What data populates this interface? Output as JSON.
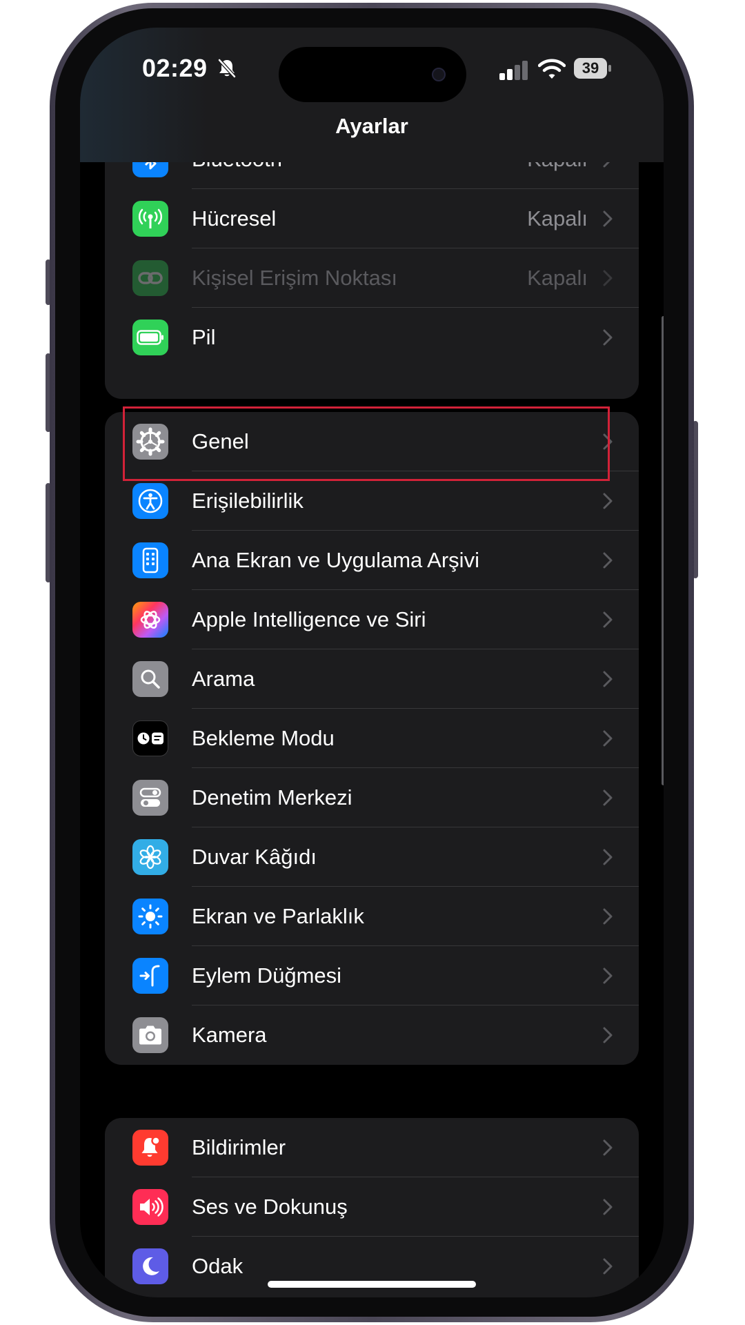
{
  "status_bar": {
    "time": "02:29",
    "battery": "39"
  },
  "header": {
    "title": "Ayarlar"
  },
  "groups": [
    {
      "rows": [
        {
          "label": "Bluetooth",
          "value": "Kapalı",
          "icon": "bluetooth-icon"
        },
        {
          "label": "Hücresel",
          "value": "Kapalı",
          "icon": "antenna-icon"
        },
        {
          "label": "Kişisel Erişim Noktası",
          "value": "Kapalı",
          "icon": "link-icon",
          "state": "disabled"
        },
        {
          "label": "Pil",
          "value": "",
          "icon": "battery-icon"
        }
      ]
    },
    {
      "rows": [
        {
          "label": "Genel",
          "icon": "gear-icon",
          "state": "highlighted"
        },
        {
          "label": "Erişilebilirlik",
          "icon": "accessibility-icon"
        },
        {
          "label": "Ana Ekran ve Uygulama Arşivi",
          "icon": "home-screen-icon"
        },
        {
          "label": "Apple Intelligence ve Siri",
          "icon": "apple-intelligence-icon"
        },
        {
          "label": "Arama",
          "icon": "magnifier-icon"
        },
        {
          "label": "Bekleme Modu",
          "icon": "standby-icon"
        },
        {
          "label": "Denetim Merkezi",
          "icon": "toggles-icon"
        },
        {
          "label": "Duvar Kâğıdı",
          "icon": "flower-icon"
        },
        {
          "label": "Ekran ve Parlaklık",
          "icon": "sun-icon"
        },
        {
          "label": "Eylem Düğmesi",
          "icon": "action-button-icon"
        },
        {
          "label": "Kamera",
          "icon": "camera-icon"
        }
      ]
    },
    {
      "rows": [
        {
          "label": "Bildirimler",
          "icon": "notification-bell-icon"
        },
        {
          "label": "Ses ve Dokunuş",
          "icon": "speaker-icon"
        },
        {
          "label": "Odak",
          "icon": "moon-icon"
        }
      ]
    }
  ],
  "colors": {
    "background": "#000000",
    "group": "#1c1c1e",
    "separator": "#38383a",
    "secondary_text": "#8e8e93",
    "highlight": "#d22238",
    "icon_bluetooth": "#0a84ff",
    "icon_green": "#30d158",
    "icon_gray": "#8e8e93",
    "icon_red": "#ff3b30",
    "icon_pink": "#ff2d55",
    "icon_indigo": "#5e5ce6",
    "icon_teal": "#32ade6"
  }
}
